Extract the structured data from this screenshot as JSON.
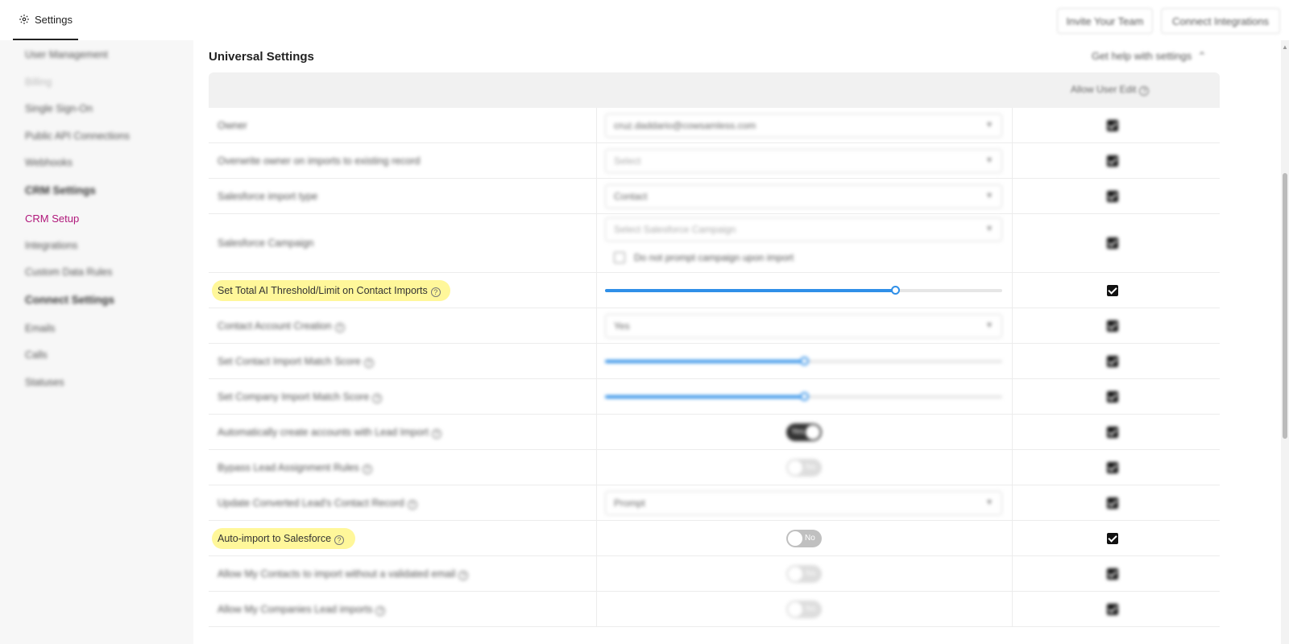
{
  "header": {
    "tab_label": "Settings",
    "invite_label": "Invite Your Team",
    "connect_label": "Connect Integrations"
  },
  "sidebar": {
    "items": [
      {
        "label": "User Management",
        "kind": "item"
      },
      {
        "label": "Billing",
        "kind": "item-faded"
      },
      {
        "label": "Single Sign-On",
        "kind": "item"
      },
      {
        "label": "Public API Connections",
        "kind": "item"
      },
      {
        "label": "Webhooks",
        "kind": "item"
      },
      {
        "label": "CRM Settings",
        "kind": "head"
      },
      {
        "label": "CRM Setup",
        "kind": "active"
      },
      {
        "label": "Integrations",
        "kind": "item"
      },
      {
        "label": "Custom Data Rules",
        "kind": "item"
      },
      {
        "label": "Connect Settings",
        "kind": "head"
      },
      {
        "label": "Emails",
        "kind": "item"
      },
      {
        "label": "Calls",
        "kind": "item"
      },
      {
        "label": "Statuses",
        "kind": "item"
      }
    ]
  },
  "main": {
    "section_title": "Universal Settings",
    "help_link": "Get help with settings",
    "allow_user_edit_header": "Allow User Edit",
    "rows": [
      {
        "label": "Owner",
        "control": "select",
        "value": "cruz.daddario@cowsamless.com",
        "allow_edit": true
      },
      {
        "label": "Overwrite owner on imports to existing record",
        "control": "select",
        "value": "Select",
        "allow_edit": true
      },
      {
        "label": "Salesforce import type",
        "control": "select",
        "value": "Contact",
        "allow_edit": true
      },
      {
        "label": "Salesforce Campaign",
        "control": "select-checkbox",
        "value": "Select Salesforce Campaign",
        "checkbox_label": "Do not prompt campaign upon import",
        "allow_edit": true
      },
      {
        "label": "Set Total AI Threshold/Limit on Contact Imports",
        "control": "slider",
        "level": 0.73,
        "allow_edit": true,
        "highlighted": true
      },
      {
        "label": "Contact Account Creation",
        "control": "select",
        "value": "Yes",
        "allow_edit": true
      },
      {
        "label": "Set Contact Import Match Score",
        "control": "slider",
        "level": 0.5,
        "allow_edit": true
      },
      {
        "label": "Set Company Import Match Score",
        "control": "slider",
        "level": 0.5,
        "allow_edit": true
      },
      {
        "label": "Automatically create accounts with Lead Import",
        "control": "toggle",
        "on": true,
        "toggle_label": "Yes",
        "allow_edit": true
      },
      {
        "label": "Bypass Lead Assignment Rules",
        "control": "toggle",
        "on": false,
        "toggle_label": "No",
        "allow_edit": true
      },
      {
        "label": "Update Converted Lead's Contact Record",
        "control": "select",
        "value": "Prompt",
        "allow_edit": true
      },
      {
        "label": "Auto-import to Salesforce",
        "control": "toggle",
        "on": false,
        "toggle_label": "No",
        "allow_edit": true,
        "highlighted": true
      },
      {
        "label": "Allow My Contacts to import without a validated email",
        "control": "toggle",
        "on": false,
        "toggle_label": "No",
        "allow_edit": true
      },
      {
        "label": "Allow My Companies Lead imports",
        "control": "toggle",
        "on": false,
        "toggle_label": "No",
        "allow_edit": true
      }
    ]
  },
  "colors": {
    "accent": "#b0177a",
    "slider": "#2f8fe8",
    "highlight": "#fff79a"
  }
}
